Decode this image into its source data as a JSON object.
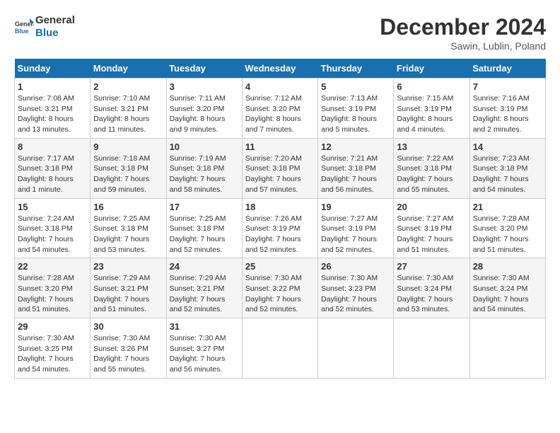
{
  "header": {
    "logo_line1": "General",
    "logo_line2": "Blue",
    "title": "December 2024",
    "location": "Sawin, Lublin, Poland"
  },
  "weekdays": [
    "Sunday",
    "Monday",
    "Tuesday",
    "Wednesday",
    "Thursday",
    "Friday",
    "Saturday"
  ],
  "weeks": [
    [
      {
        "day": "1",
        "sunrise": "Sunrise: 7:08 AM",
        "sunset": "Sunset: 3:21 PM",
        "daylight": "Daylight: 8 hours and 13 minutes."
      },
      {
        "day": "2",
        "sunrise": "Sunrise: 7:10 AM",
        "sunset": "Sunset: 3:21 PM",
        "daylight": "Daylight: 8 hours and 11 minutes."
      },
      {
        "day": "3",
        "sunrise": "Sunrise: 7:11 AM",
        "sunset": "Sunset: 3:20 PM",
        "daylight": "Daylight: 8 hours and 9 minutes."
      },
      {
        "day": "4",
        "sunrise": "Sunrise: 7:12 AM",
        "sunset": "Sunset: 3:20 PM",
        "daylight": "Daylight: 8 hours and 7 minutes."
      },
      {
        "day": "5",
        "sunrise": "Sunrise: 7:13 AM",
        "sunset": "Sunset: 3:19 PM",
        "daylight": "Daylight: 8 hours and 5 minutes."
      },
      {
        "day": "6",
        "sunrise": "Sunrise: 7:15 AM",
        "sunset": "Sunset: 3:19 PM",
        "daylight": "Daylight: 8 hours and 4 minutes."
      },
      {
        "day": "7",
        "sunrise": "Sunrise: 7:16 AM",
        "sunset": "Sunset: 3:19 PM",
        "daylight": "Daylight: 8 hours and 2 minutes."
      }
    ],
    [
      {
        "day": "8",
        "sunrise": "Sunrise: 7:17 AM",
        "sunset": "Sunset: 3:18 PM",
        "daylight": "Daylight: 8 hours and 1 minute."
      },
      {
        "day": "9",
        "sunrise": "Sunrise: 7:18 AM",
        "sunset": "Sunset: 3:18 PM",
        "daylight": "Daylight: 7 hours and 59 minutes."
      },
      {
        "day": "10",
        "sunrise": "Sunrise: 7:19 AM",
        "sunset": "Sunset: 3:18 PM",
        "daylight": "Daylight: 7 hours and 58 minutes."
      },
      {
        "day": "11",
        "sunrise": "Sunrise: 7:20 AM",
        "sunset": "Sunset: 3:18 PM",
        "daylight": "Daylight: 7 hours and 57 minutes."
      },
      {
        "day": "12",
        "sunrise": "Sunrise: 7:21 AM",
        "sunset": "Sunset: 3:18 PM",
        "daylight": "Daylight: 7 hours and 56 minutes."
      },
      {
        "day": "13",
        "sunrise": "Sunrise: 7:22 AM",
        "sunset": "Sunset: 3:18 PM",
        "daylight": "Daylight: 7 hours and 55 minutes."
      },
      {
        "day": "14",
        "sunrise": "Sunrise: 7:23 AM",
        "sunset": "Sunset: 3:18 PM",
        "daylight": "Daylight: 7 hours and 54 minutes."
      }
    ],
    [
      {
        "day": "15",
        "sunrise": "Sunrise: 7:24 AM",
        "sunset": "Sunset: 3:18 PM",
        "daylight": "Daylight: 7 hours and 54 minutes."
      },
      {
        "day": "16",
        "sunrise": "Sunrise: 7:25 AM",
        "sunset": "Sunset: 3:18 PM",
        "daylight": "Daylight: 7 hours and 53 minutes."
      },
      {
        "day": "17",
        "sunrise": "Sunrise: 7:25 AM",
        "sunset": "Sunset: 3:18 PM",
        "daylight": "Daylight: 7 hours and 52 minutes."
      },
      {
        "day": "18",
        "sunrise": "Sunrise: 7:26 AM",
        "sunset": "Sunset: 3:19 PM",
        "daylight": "Daylight: 7 hours and 52 minutes."
      },
      {
        "day": "19",
        "sunrise": "Sunrise: 7:27 AM",
        "sunset": "Sunset: 3:19 PM",
        "daylight": "Daylight: 7 hours and 52 minutes."
      },
      {
        "day": "20",
        "sunrise": "Sunrise: 7:27 AM",
        "sunset": "Sunset: 3:19 PM",
        "daylight": "Daylight: 7 hours and 51 minutes."
      },
      {
        "day": "21",
        "sunrise": "Sunrise: 7:28 AM",
        "sunset": "Sunset: 3:20 PM",
        "daylight": "Daylight: 7 hours and 51 minutes."
      }
    ],
    [
      {
        "day": "22",
        "sunrise": "Sunrise: 7:28 AM",
        "sunset": "Sunset: 3:20 PM",
        "daylight": "Daylight: 7 hours and 51 minutes."
      },
      {
        "day": "23",
        "sunrise": "Sunrise: 7:29 AM",
        "sunset": "Sunset: 3:21 PM",
        "daylight": "Daylight: 7 hours and 51 minutes."
      },
      {
        "day": "24",
        "sunrise": "Sunrise: 7:29 AM",
        "sunset": "Sunset: 3:21 PM",
        "daylight": "Daylight: 7 hours and 52 minutes."
      },
      {
        "day": "25",
        "sunrise": "Sunrise: 7:30 AM",
        "sunset": "Sunset: 3:22 PM",
        "daylight": "Daylight: 7 hours and 52 minutes."
      },
      {
        "day": "26",
        "sunrise": "Sunrise: 7:30 AM",
        "sunset": "Sunset: 3:23 PM",
        "daylight": "Daylight: 7 hours and 52 minutes."
      },
      {
        "day": "27",
        "sunrise": "Sunrise: 7:30 AM",
        "sunset": "Sunset: 3:24 PM",
        "daylight": "Daylight: 7 hours and 53 minutes."
      },
      {
        "day": "28",
        "sunrise": "Sunrise: 7:30 AM",
        "sunset": "Sunset: 3:24 PM",
        "daylight": "Daylight: 7 hours and 54 minutes."
      }
    ],
    [
      {
        "day": "29",
        "sunrise": "Sunrise: 7:30 AM",
        "sunset": "Sunset: 3:25 PM",
        "daylight": "Daylight: 7 hours and 54 minutes."
      },
      {
        "day": "30",
        "sunrise": "Sunrise: 7:30 AM",
        "sunset": "Sunset: 3:26 PM",
        "daylight": "Daylight: 7 hours and 55 minutes."
      },
      {
        "day": "31",
        "sunrise": "Sunrise: 7:30 AM",
        "sunset": "Sunset: 3:27 PM",
        "daylight": "Daylight: 7 hours and 56 minutes."
      },
      null,
      null,
      null,
      null
    ]
  ]
}
